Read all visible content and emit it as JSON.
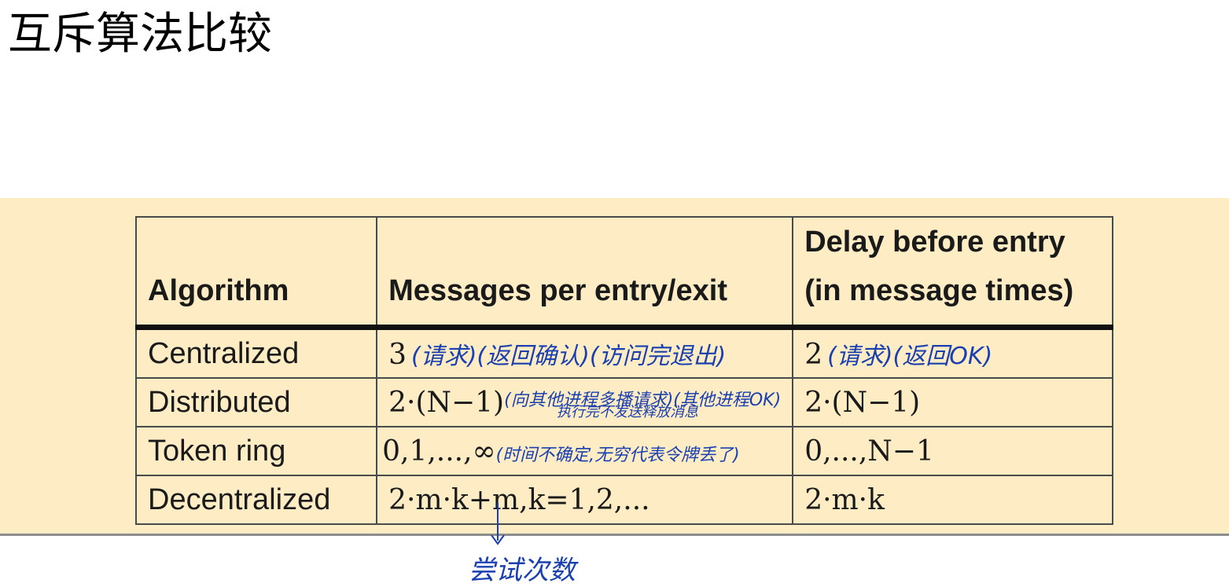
{
  "title": "互斥算法比较",
  "table": {
    "headers": [
      "Algorithm",
      "Messages per entry/exit",
      "Delay before entry (in message times)"
    ],
    "rows": [
      {
        "algorithm": "Centralized",
        "messages": "3",
        "messages_note": "(请求)(返回确认)(访问完退出)",
        "delay": "2",
        "delay_note": "(请求)(返回OK)"
      },
      {
        "algorithm": "Distributed",
        "messages": "2·(N−1)",
        "messages_note": "(向其他进程多播请求)(其他进程OK)",
        "messages_note2": "执行完不发送释放消息",
        "delay": "2·(N−1)",
        "delay_note": ""
      },
      {
        "algorithm": "Token ring",
        "messages": "0,1,...,∞",
        "messages_note": "(时间不确定,无穷代表令牌丢了)",
        "delay": "0,...,N−1",
        "delay_note": ""
      },
      {
        "algorithm": "Decentralized",
        "messages": "2·m·k+m,k=1,2,...",
        "messages_note": "",
        "delay": "2·m·k",
        "delay_note": ""
      }
    ]
  },
  "annotation_bottom": "尝试次数",
  "colors": {
    "band": "#fdecc4",
    "ink": "#1a3fb0"
  }
}
